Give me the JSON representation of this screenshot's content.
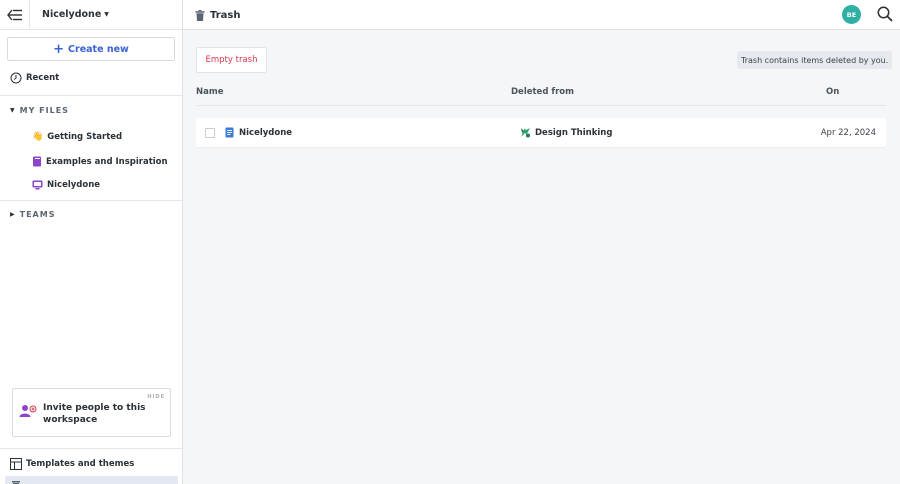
{
  "sidebar": {
    "workspace_name": "Nicelydone",
    "create_label": "Create new",
    "recent_label": "Recent",
    "my_files_label": "MY FILES",
    "files": [
      {
        "label": "Getting Started",
        "icon": "waving-hand-icon"
      },
      {
        "label": "Examples and Inspiration",
        "icon": "book-icon"
      },
      {
        "label": "Nicelydone",
        "icon": "monitor-icon"
      }
    ],
    "teams_label": "TEAMS",
    "invite": {
      "hide_label": "HIDE",
      "text": "Invite people to this workspace"
    },
    "templates_label": "Templates and themes"
  },
  "header": {
    "title": "Trash",
    "avatar_initials": "BE"
  },
  "main": {
    "empty_trash_label": "Empty trash",
    "notice": "Trash contains items deleted by you.",
    "columns": {
      "name": "Name",
      "deleted_from": "Deleted from",
      "on": "On"
    },
    "rows": [
      {
        "name": "Nicelydone",
        "deleted_from": "Design Thinking",
        "on": "Apr 22, 2024"
      }
    ]
  },
  "colors": {
    "accent": "#3a62cf",
    "danger": "#d9364d",
    "avatar": "#2fb0a4",
    "selected_nav": "#e4e9f1"
  }
}
